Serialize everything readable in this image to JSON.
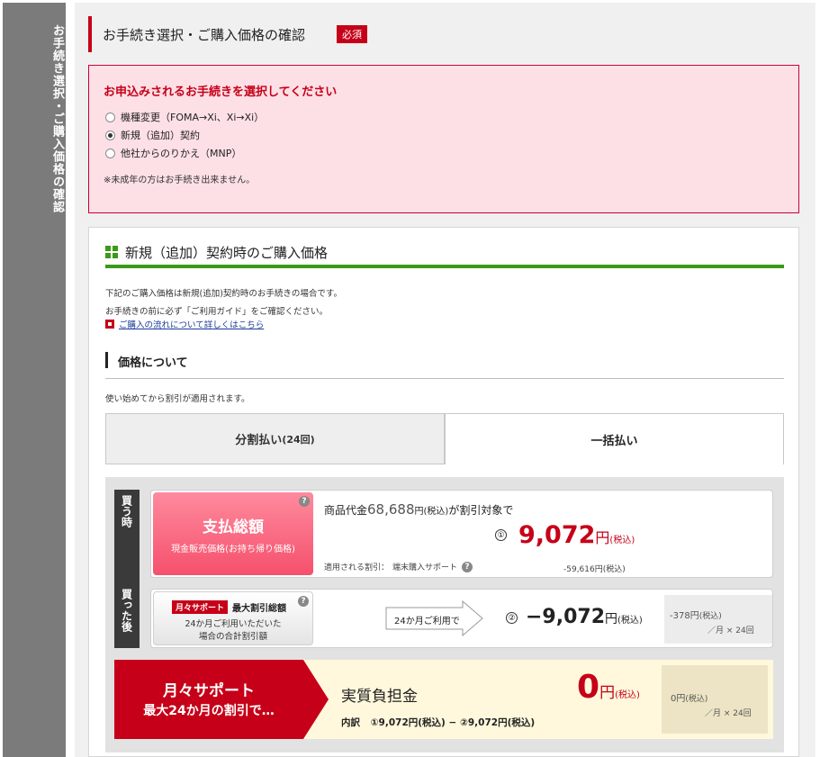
{
  "side_tab": {
    "label": "お手続き選択・ご購入価格の確認"
  },
  "section": {
    "title": "お手続き選択・ご購入価格の確認",
    "required_badge": "必須"
  },
  "procedure": {
    "heading": "お申込みされるお手続きを選択してください",
    "options": [
      {
        "label": "機種変更（FOMA→Xi、Xi→Xi）",
        "selected": false
      },
      {
        "label": "新規（追加）契約",
        "selected": true
      },
      {
        "label": "他社からのりかえ（MNP）",
        "selected": false
      }
    ],
    "note": "※未成年の方はお手続き出来ません。"
  },
  "price_section": {
    "title": "新規（追加）契約時のご購入価格",
    "desc1": "下記のご購入価格は新規(追加)契約時のお手続きの場合です。",
    "desc2": "お手続きの前に必ず「ご利用ガイド」をご確認ください。",
    "link": "ご購入の流れについて詳しくはこちら",
    "subheading": "価格について",
    "discount_note": "使い始めてから割引が適用されます。"
  },
  "payment_tabs": {
    "installment": {
      "label": "分割払い",
      "count": "(24回)"
    },
    "lump_sum": {
      "label": "一括払い"
    }
  },
  "phases": {
    "purchase": "買う時",
    "after": "買った後"
  },
  "total_card": {
    "button_title": "支払総額",
    "button_sub": "現金販売価格(お持ち帰り価格)",
    "help": "?",
    "product_prefix": "商品代金",
    "product_price": "68,688",
    "product_unit": "円(税込)",
    "product_suffix": "が割引対象で",
    "circle": "①",
    "price": "9,072",
    "price_unit": "円",
    "price_tax": "(税込)",
    "discount_label": "適用される割引：",
    "discount_name": "端末購入サポート",
    "discount_amount": "-59,616円(税込)"
  },
  "monthly_card": {
    "badge": "月々サポート",
    "badge_label": "最大割引総額",
    "line2": "24か月ご利用いただいた",
    "line3": "場合の合計割引額",
    "help": "?",
    "arrow_label": "24か月ご利用で",
    "circle": "②",
    "price": "−9,072",
    "price_unit": "円",
    "price_tax": "(税込)",
    "monthly_amount": "-378円",
    "monthly_tax": "(税込)",
    "monthly_per": "／月 × 24回"
  },
  "final": {
    "title": "月々サポート",
    "subtitle": "最大24か月の割引で…",
    "label": "実質負担金",
    "price": "0",
    "price_unit": "円",
    "price_tax": "(税込)",
    "breakdown_label": "内訳",
    "breakdown": "①9,072円(税込) − ②9,072円(税込)",
    "monthly_amount": "0円",
    "monthly_tax": "(税込)",
    "monthly_per": "／月 × 24回"
  }
}
